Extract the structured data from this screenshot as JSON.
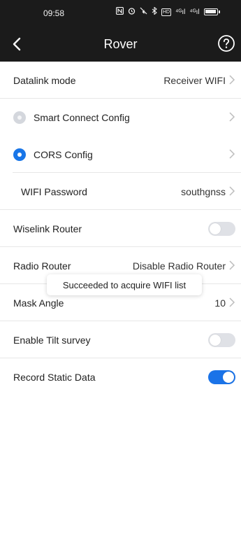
{
  "status_bar": {
    "time": "09:58",
    "icons": [
      "nfc-icon",
      "alarm-icon",
      "mute-icon",
      "bluetooth-icon",
      "hd-icon",
      "signal-icon",
      "signal-icon",
      "battery-icon"
    ],
    "hd_text": "HD",
    "signal1_text": "⁴ᴳıl",
    "signal2_text": "⁴ᴳıl",
    "battery_level": 0.9
  },
  "title_bar": {
    "title": "Rover",
    "back_icon": "chevron-left-icon",
    "help_icon": "help-circle-icon"
  },
  "settings": {
    "datalink_mode": {
      "label": "Datalink mode",
      "value": "Receiver WIFI"
    },
    "smart_connect": {
      "label": "Smart Connect Config",
      "selected": false
    },
    "cors_config": {
      "label": "CORS Config",
      "selected": true
    },
    "wifi_password": {
      "label": "WIFI Password",
      "value": "southgnss"
    },
    "wiselink_router": {
      "label": "Wiselink Router",
      "enabled": false
    },
    "radio_router": {
      "label": "Radio Router",
      "value": "Disable Radio Router"
    },
    "mask_angle": {
      "label": "Mask Angle",
      "value": "10"
    },
    "tilt_survey": {
      "label": "Enable Tilt survey",
      "enabled": false
    },
    "record_static": {
      "label": "Record Static Data",
      "enabled": true
    }
  },
  "toast": {
    "message": "Succeeded to acquire WIFI list"
  },
  "colors": {
    "header_bg": "#1b1b1b",
    "accent": "#1a73e8",
    "toggle_off": "#dfe1e6",
    "divider": "#e7e7e7"
  }
}
